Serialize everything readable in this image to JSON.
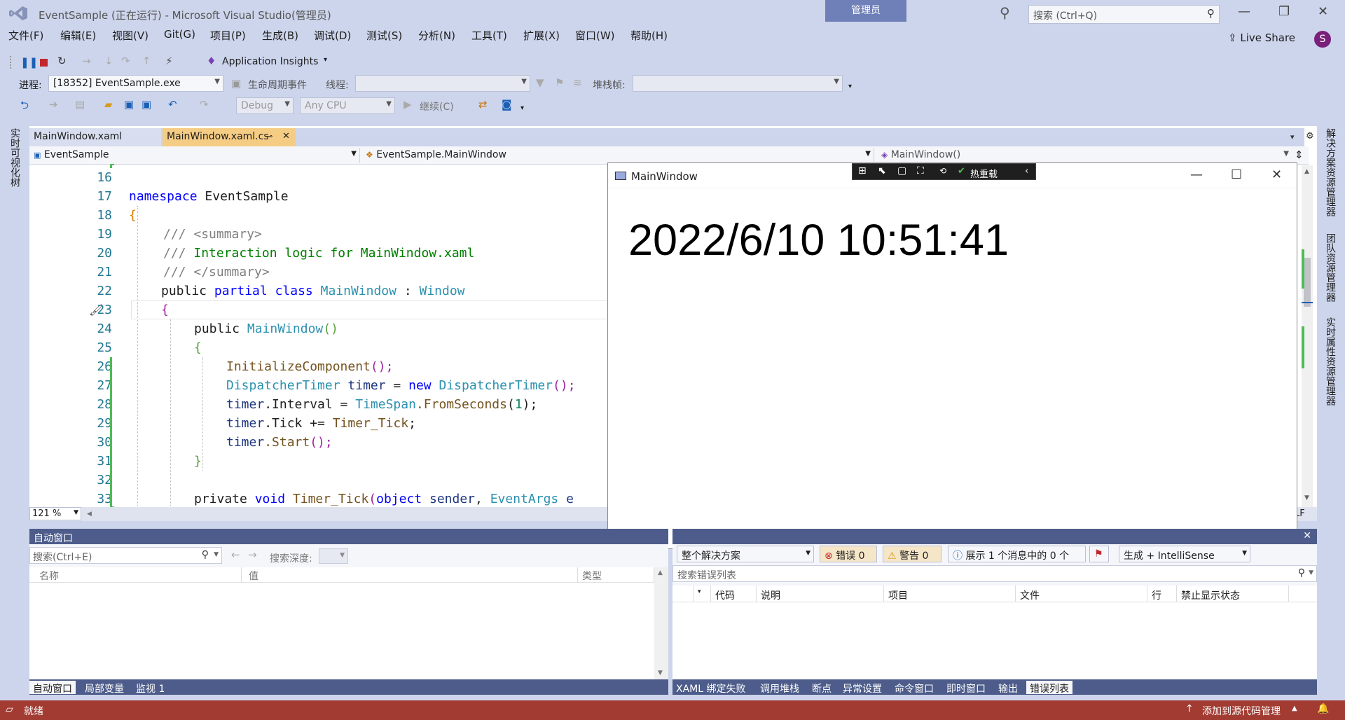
{
  "window": {
    "title": "EventSample (正在运行) - Microsoft Visual Studio(管理员)",
    "admin_badge": "管理员",
    "search_placeholder": "搜索 (Ctrl+Q)",
    "live_share": "Live Share",
    "avatar_letter": "S"
  },
  "menu": [
    "文件(F)",
    "编辑(E)",
    "视图(V)",
    "Git(G)",
    "项目(P)",
    "生成(B)",
    "调试(D)",
    "测试(S)",
    "分析(N)",
    "工具(T)",
    "扩展(X)",
    "窗口(W)",
    "帮助(H)"
  ],
  "toolbar": {
    "app_insights": "Application Insights",
    "process_label": "进程:",
    "process_value": "[18352] EventSample.exe",
    "lifecycle": "生命周期事件",
    "thread_label": "线程:",
    "stackframe_label": "堆栈帧:",
    "config": "Debug",
    "platform": "Any CPU",
    "continue": "继续(C)"
  },
  "tabs": [
    {
      "label": "MainWindow.xaml",
      "active": false
    },
    {
      "label": "MainWindow.xaml.cs",
      "active": true
    }
  ],
  "navbar": {
    "project": "EventSample",
    "type": "EventSample.MainWindow",
    "member": "MainWindow()"
  },
  "line_numbers": [
    "16",
    "17",
    "18",
    "19",
    "20",
    "21",
    "22",
    "23",
    "24",
    "25",
    "26",
    "27",
    "28",
    "29",
    "30",
    "31",
    "32",
    "33"
  ],
  "code_text": {
    "ns_kw": "namespace",
    "ns_name": "EventSample",
    "open1": "{",
    "c1a": "/// ",
    "c1b": "<summary>",
    "c2a": "/// ",
    "c2b": "Interaction logic for MainWindow.xaml",
    "c3a": "/// ",
    "c3b": "</summary>",
    "cls_public": "public",
    "cls_partial": "partial",
    "cls_class": "class",
    "cls_name": "MainWindow",
    "cls_colon": " : ",
    "cls_base": "Window",
    "open2": "{",
    "ctor_public": "public",
    "ctor_name": "MainWindow",
    "ctor_parens": "()",
    "open3": "{",
    "init_call": "InitializeComponent",
    "init_tail": "();",
    "dt_type": "DispatcherTimer",
    "dt_var": "timer",
    "dt_eq": " = ",
    "dt_new": "new",
    "dt_type2": "DispatcherTimer",
    "dt_tail": "();",
    "iv_var": "timer",
    "iv_prop": ".Interval = ",
    "iv_ts": "TimeSpan",
    "iv_fs": ".FromSeconds",
    "iv_arg": "1",
    "iv_tail": ");",
    "tk_var": "timer",
    "tk_mid": ".Tick += ",
    "tk_handler": "Timer_Tick",
    "tk_tail": ";",
    "st_var": "timer",
    "st_call": ".Start",
    "st_tail": "();",
    "close3": "}",
    "pv_private": "private",
    "pv_void": "void",
    "pv_name": "Timer_Tick",
    "pv_open": "(",
    "pv_object": "object",
    "pv_sender": "sender",
    "pv_comma": ", ",
    "pv_eargs": "EventArgs",
    "pv_e": "e"
  },
  "zoom": "121 %",
  "line_ending": "LF",
  "app_window": {
    "title": "MainWindow",
    "clock_text": "2022/6/10 10:51:41",
    "hot_reload": "热重载"
  },
  "autos": {
    "title": "自动窗口",
    "search_placeholder": "搜索(Ctrl+E)",
    "search_depth": "搜索深度:",
    "columns": [
      "名称",
      "值",
      "类型"
    ],
    "tabs": [
      "自动窗口",
      "局部变量",
      "监视 1"
    ]
  },
  "errors": {
    "scope": "整个解决方案",
    "errors_label": "错误 0",
    "warnings_label": "警告 0",
    "messages_label": "展示 1 个消息中的 0 个",
    "build_filter": "生成 + IntelliSense",
    "search_placeholder": "搜索错误列表",
    "columns": [
      "代码",
      "说明",
      "项目",
      "文件",
      "行",
      "禁止显示状态"
    ],
    "tabs": [
      "XAML 绑定失败",
      "调用堆栈",
      "断点",
      "异常设置",
      "命令窗口",
      "即时窗口",
      "输出",
      "错误列表"
    ]
  },
  "side_left": "实时可视化树",
  "side_right": [
    "解决方案资源管理器",
    "团队资源管理器",
    "实时属性资源管理器"
  ],
  "status": {
    "ready": "就绪",
    "source_control": "添加到源代码管理"
  }
}
